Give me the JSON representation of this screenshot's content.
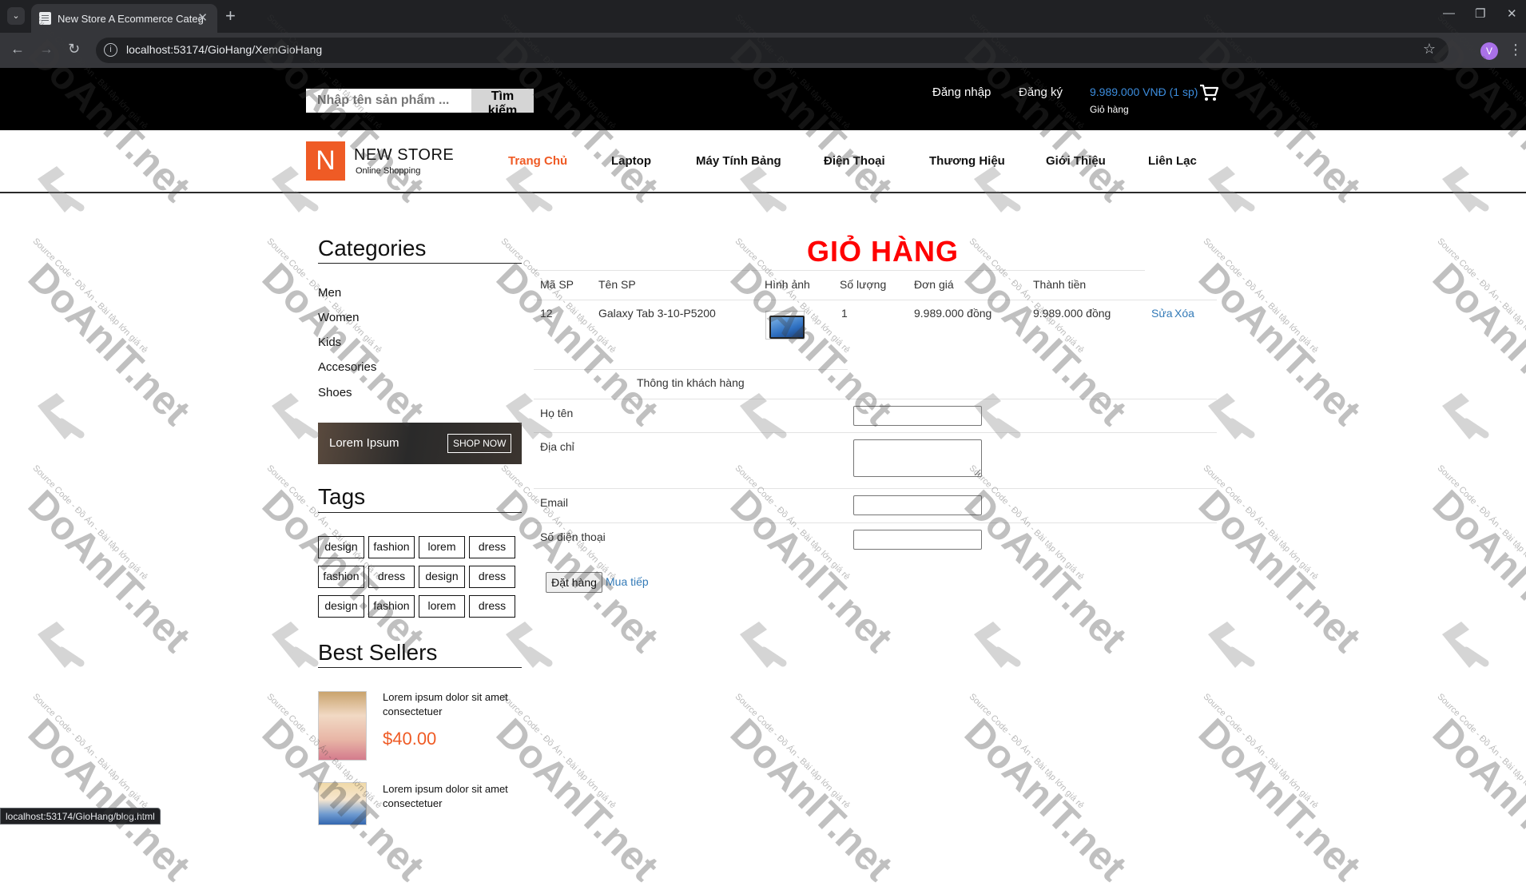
{
  "browser": {
    "tab_title": "New Store A Ecommerce Categ",
    "url": "localhost:53174/GioHang/XemGioHang",
    "profile_initial": "V",
    "status_url": "localhost:53174/GioHang/blog.html"
  },
  "header": {
    "search_placeholder": "Nhập tên sản phẩm ...",
    "search_button": "Tìm kiếm",
    "login": "Đăng nhập",
    "register": "Đăng ký",
    "cart_amount": "9.989.000 VNĐ (1 sp)",
    "cart_label": "Giỏ hàng"
  },
  "logo": {
    "letter": "N",
    "name": "NEW STORE",
    "tagline": "Online Shopping"
  },
  "nav": [
    "Trang Chủ",
    "Laptop",
    "Máy Tính Bảng",
    "Điện Thoại",
    "Thương Hiệu",
    "Giới Thiệu",
    "Liên Lạc"
  ],
  "sidebar": {
    "categories_title": "Categories",
    "categories": [
      "Men",
      "Women",
      "Kids",
      "Accesories",
      "Shoes"
    ],
    "banner_text": "Lorem Ipsum",
    "banner_button": "SHOP NOW",
    "tags_title": "Tags",
    "tags": [
      "design",
      "fashion",
      "lorem",
      "dress",
      "fashion",
      "dress",
      "design",
      "dress",
      "design",
      "fashion",
      "lorem",
      "dress"
    ],
    "best_sellers_title": "Best Sellers",
    "best_sellers": [
      {
        "line1": "Lorem ipsum dolor sit amet",
        "line2": "consectetuer",
        "price": "$40.00"
      },
      {
        "line1": "Lorem ipsum dolor sit amet",
        "line2": "consectetuer",
        "price": ""
      }
    ]
  },
  "cart": {
    "title": "GIỎ HÀNG",
    "columns": [
      "Mã SP",
      "Tên SP",
      "Hình ảnh",
      "Số lượng",
      "Đơn giá",
      "Thành tiền"
    ],
    "rows": [
      {
        "id": "12",
        "name": "Galaxy Tab 3-10-P5200",
        "qty": "1",
        "unit_price": "9.989.000 đồng",
        "total": "9.989.000 đồng",
        "edit": "Sửa",
        "delete": "Xóa"
      }
    ]
  },
  "customer_form": {
    "title": "Thông tin khách hàng",
    "fullname_label": "Họ tên",
    "address_label": "Địa chỉ",
    "email_label": "Email",
    "phone_label": "Số điện thoại",
    "order_button": "Đặt hàng",
    "continue_link": "Mua tiếp"
  },
  "watermark": {
    "brand": "DoAnIT.net",
    "tagline": "Source Code - Đồ Án - Bài tập lớn giá rẻ"
  }
}
